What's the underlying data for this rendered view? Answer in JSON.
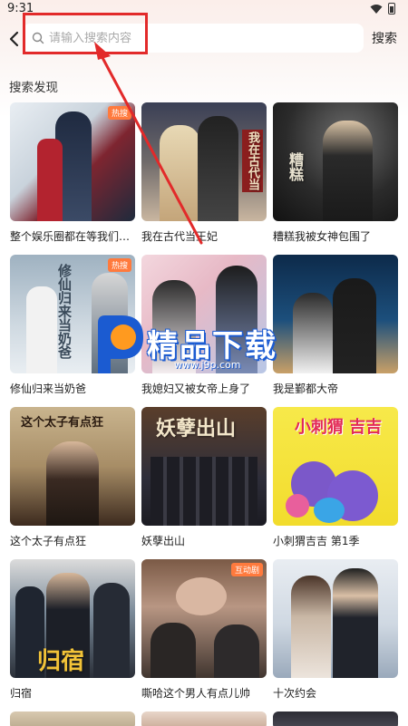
{
  "status_bar": {
    "time": "9:31"
  },
  "search": {
    "placeholder": "请输入搜索内容",
    "value": "",
    "button_label": "搜索"
  },
  "section": {
    "title": "搜索发现"
  },
  "items": [
    {
      "title": "整个娱乐圈都在等我们离...",
      "badge": "热搜",
      "poster_text": ""
    },
    {
      "title": "我在古代当王妃",
      "badge": "",
      "poster_text": "我在古代当"
    },
    {
      "title": "糟糕我被女神包围了",
      "badge": "",
      "poster_text": "糟糕"
    },
    {
      "title": "修仙归来当奶爸",
      "badge": "热搜",
      "poster_text": "修仙归来当奶爸"
    },
    {
      "title": "我媳妇又被女帝上身了",
      "badge": "",
      "poster_text": ""
    },
    {
      "title": "我是鄞都大帝",
      "badge": "",
      "poster_text": ""
    },
    {
      "title": "这个太子有点狂",
      "badge": "",
      "poster_text": "这个太子有点狂"
    },
    {
      "title": "妖孽出山",
      "badge": "",
      "poster_text": "妖孽出山"
    },
    {
      "title": "小刺猬吉吉 第1季",
      "badge": "",
      "poster_text": "小刺猬 吉吉"
    },
    {
      "title": "归宿",
      "badge": "",
      "poster_text": "归宿"
    },
    {
      "title": "嘶哈这个男人有点儿帅",
      "badge": "互动剧",
      "poster_text": ""
    },
    {
      "title": "十次约会",
      "badge": "",
      "poster_text": ""
    },
    {
      "title": "",
      "badge": "",
      "poster_text": ""
    },
    {
      "title": "",
      "badge": "",
      "poster_text": ""
    },
    {
      "title": "",
      "badge": "",
      "poster_text": ""
    }
  ],
  "watermark": {
    "brand": "精品下载",
    "url": "www.j9p.com"
  },
  "colors": {
    "accent_red": "#e22a2a",
    "badge_orange": "#ff7a3d",
    "watermark_blue": "#1b5bd1",
    "watermark_orange": "#ff9a1f"
  },
  "icons": {
    "back": "chevron-left-icon",
    "search": "search-icon",
    "wifi": "wifi-icon",
    "battery": "battery-icon"
  }
}
